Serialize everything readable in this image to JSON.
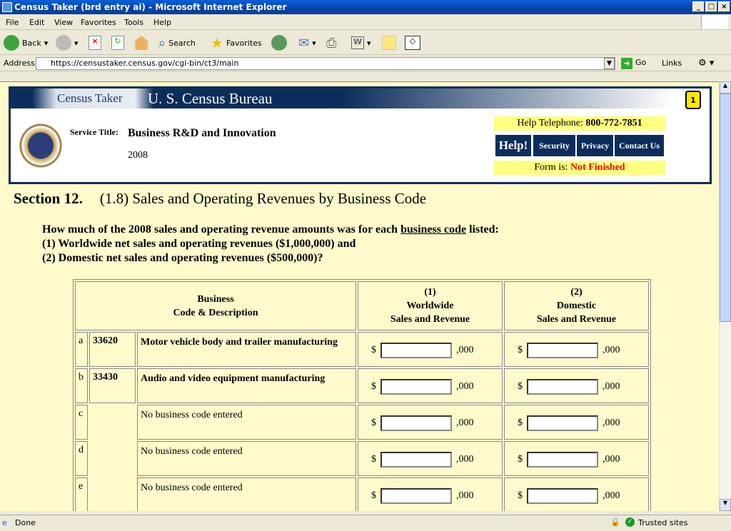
{
  "window": {
    "title": "Census Taker (brd entry ai) - Microsoft Internet Explorer"
  },
  "menu": [
    "File",
    "Edit",
    "View",
    "Favorites",
    "Tools",
    "Help"
  ],
  "toolbar": {
    "back": "Back",
    "search": "Search",
    "favorites": "Favorites"
  },
  "address": {
    "label": "Address",
    "url": "https://censustaker.census.gov/cgi-bin/ct3/main",
    "go": "Go",
    "links": "Links"
  },
  "header": {
    "census_taker": "Census Taker",
    "bureau": "U. S. Census Bureau",
    "service_title_label": "Service Title:",
    "service_title": "Business R&D and Innovation",
    "year": "2008",
    "help_phone_label": "Help Telephone:",
    "help_phone": "800-772-7851",
    "help": "Help!",
    "security": "Security",
    "privacy": "Privacy",
    "contact": "Contact Us",
    "form_status_label": "Form is:",
    "form_status": "Not Finished",
    "status_color": "#ff0000"
  },
  "section": {
    "number": "Section 12.",
    "title": "(1.8) Sales and Operating Revenues by Business Code",
    "q_pre": "How much of the 2008 sales and operating revenue amounts was for each ",
    "q_link": "business code",
    "q_post": " listed:",
    "q_line2": "(1) Worldwide net sales and operating revenues ($1,000,000) and",
    "q_line3": "(2) Domestic net sales and operating revenues ($500,000)?"
  },
  "table": {
    "col1_line1": "Business",
    "col1_line2": "Code & Description",
    "col2_line1": "(1)",
    "col2_line2": "Worldwide",
    "col2_line3": "Sales and Revenue",
    "col3_line1": "(2)",
    "col3_line2": "Domestic",
    "col3_line3": "Sales and Revenue",
    "currency": "$",
    "suffix": ",000",
    "rows": [
      {
        "letter": "a",
        "code": "33620",
        "desc": "Motor vehicle body and trailer manufacturing",
        "worldwide": "",
        "domestic": ""
      },
      {
        "letter": "b",
        "code": "33430",
        "desc": "Audio and video equipment manufacturing",
        "worldwide": "",
        "domestic": ""
      },
      {
        "letter": "c",
        "code": "",
        "desc": "No business code entered",
        "worldwide": "",
        "domestic": ""
      },
      {
        "letter": "d",
        "code": "",
        "desc": "No business code entered",
        "worldwide": "",
        "domestic": ""
      },
      {
        "letter": "e",
        "code": "",
        "desc": "No business code entered",
        "worldwide": "",
        "domestic": ""
      }
    ]
  },
  "status": {
    "text": "Done",
    "zone": "Trusted sites"
  }
}
